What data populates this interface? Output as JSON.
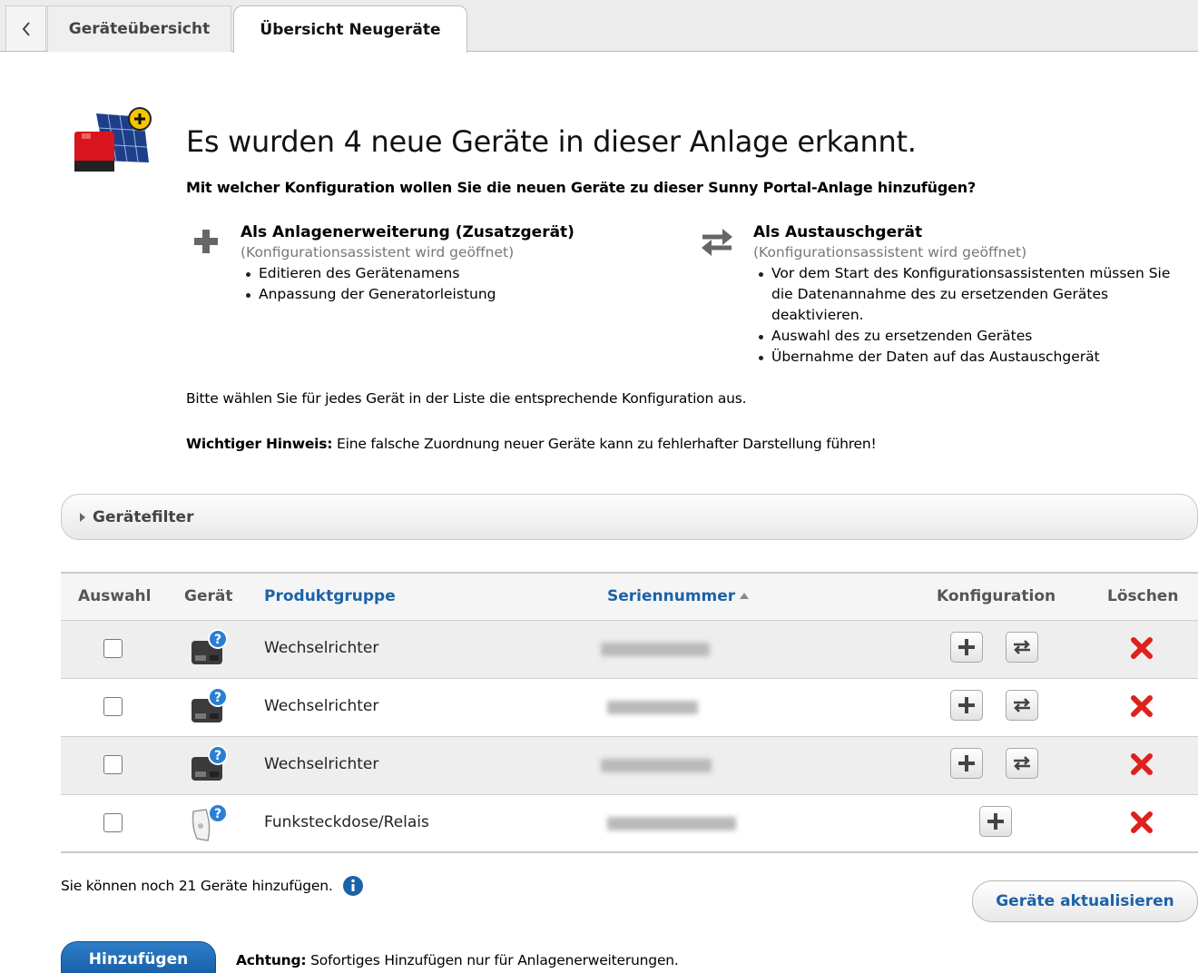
{
  "tabs": {
    "overview": "Geräteübersicht",
    "new_devices": "Übersicht Neugeräte"
  },
  "header": {
    "title": "Es wurden 4 neue Geräte in dieser Anlage erkannt.",
    "question": "Mit welcher Konfiguration wollen Sie die neuen Geräte zu dieser Sunny Portal-Anlage hinzufügen?"
  },
  "options": {
    "extension": {
      "title": "Als Anlagenerweiterung (Zusatzgerät)",
      "subtitle": "(Konfigurationsassistent wird geöffnet)",
      "bullets": [
        "Editieren des Gerätenamens",
        "Anpassung der Generatorleistung"
      ]
    },
    "replacement": {
      "title": "Als Austauschgerät",
      "subtitle": "(Konfigurationsassistent wird geöffnet)",
      "bullets": [
        "Vor dem Start des Konfigurationsassistenten müssen Sie die Datenannahme des zu ersetzenden Gerätes deaktivieren.",
        "Auswahl des zu ersetzenden Gerätes",
        "Übernahme der Daten auf das Austauschgerät"
      ]
    }
  },
  "instructions": {
    "choose": "Bitte wählen Sie für jedes Gerät in der Liste die entsprechende Konfiguration aus.",
    "note_label": "Wichtiger Hinweis:",
    "note_text": " Eine falsche Zuordnung neuer Geräte kann zu fehlerhafter Darstellung führen!"
  },
  "filter": {
    "label": "Gerätefilter"
  },
  "table": {
    "headers": {
      "select": "Auswahl",
      "device": "Gerät",
      "group": "Produktgruppe",
      "serial": "Seriennummer",
      "config": "Konfiguration",
      "delete": "Löschen"
    },
    "rows": [
      {
        "group": "Wechselrichter",
        "icon": "inverter-icon",
        "config": [
          "add",
          "replace"
        ]
      },
      {
        "group": "Wechselrichter",
        "icon": "inverter-icon",
        "config": [
          "add",
          "replace"
        ]
      },
      {
        "group": "Wechselrichter",
        "icon": "inverter-icon",
        "config": [
          "add",
          "replace"
        ]
      },
      {
        "group": "Funksteckdose/Relais",
        "icon": "radio-socket-icon",
        "config": [
          "add"
        ]
      }
    ]
  },
  "footer": {
    "remaining": "Sie können noch 21 Geräte hinzufügen.",
    "refresh_button": "Geräte aktualisieren",
    "add_button": "Hinzufügen",
    "warning_label": "Achtung:",
    "warning_text": " Sofortiges Hinzufügen nur für Anlagenerweiterungen."
  },
  "colors": {
    "link_blue": "#1c62a8",
    "primary_button": "#155ea6",
    "delete_red": "#e0201b",
    "row_shade": "#eeeeee"
  }
}
